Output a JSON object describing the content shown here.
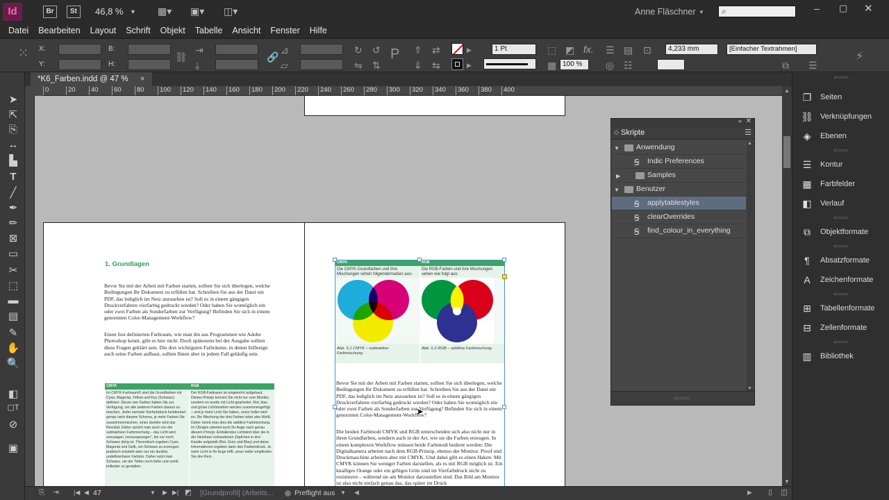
{
  "appbar": {
    "logo": "Id",
    "bridge": "Br",
    "stock": "St",
    "zoom": "46,8 %",
    "user": "Anne Fläschner"
  },
  "menu": [
    "Datei",
    "Bearbeiten",
    "Layout",
    "Schrift",
    "Objekt",
    "Tabelle",
    "Ansicht",
    "Fenster",
    "Hilfe"
  ],
  "control": {
    "x_label": "X:",
    "y_label": "Y:",
    "b_label": "B:",
    "h_label": "H:",
    "stroke_weight": "1 Pt",
    "opacity": "100 %",
    "fx": "fx.",
    "size_value": "4,233 mm",
    "frame_style": "[Einfacher Textrahmen]"
  },
  "tab": {
    "title": "*K6_Farben.indd @ 47 %",
    "close": "×"
  },
  "ruler": {
    "ticks": [
      "0",
      "20",
      "40",
      "60",
      "80",
      "100",
      "120",
      "140",
      "160",
      "180",
      "200",
      "220",
      "240",
      "260",
      "280",
      "300",
      "320",
      "340",
      "360",
      "380",
      "400"
    ]
  },
  "left_page": {
    "heading": "1.  Grundlagen",
    "para1": "Bevor Sie mit der Arbeit mit Farben starten, sollten Sie sich überlegen, welche Bedingungen Ihr Dokument zu erfüllen hat. Schreiben Sie aus der Datei ein PDF, das lediglich im Netz anzusehen ist? Soll es in einem gängigen Druckverfahren vierfarbig gedruckt werden? Oder haben Sie womöglich ein oder zwei Farben als Sonderfarben zur Verfügung? Befinden Sie sich in einem genormten Color-Management-Workflow?",
    "para2": "Einen fest definierten Farbraum, wie man ihn aus Programmen wie Adobe Photoshop kennt, gibt es hier nicht. Doch spätestens bei der Ausgabe sollten diese Fragen geklärt sein. Die drei wichtigsten Farbräume, in denen InDesign auch seine Farben aufbaut, sollten Ihnen aber in jedem Fall geläufig sein.",
    "table_h1": "CMYK",
    "table_h2": "RGB",
    "table_col1": "Im CMYK-Farbraum® sind die Grundfarben mit Cyan, Magenta, Yellow und Key (Schwarz) definiert. Dieser vier Farben haben Sie zur Verfügung, um alle anderen Farben daraus zu mischen. Jeder normale Vierfarbdruck funktioniert genau nach diesem Schema, je mehr Farben Sie zusammenmischen, umso dunkler wird das Resultat. Daher spricht man auch von der subtraktiven Farbmischung – das Licht wird sozusagen „herausgezogen“, bis nur noch Schwarz übrig ist. Theoretisch ergeben Cyan, Magenta und Gelb, um Schwarz zu erzeugen; praktisch entsteht aber nur ein dunkler, undefinierbarer Farbton. Daher nutzt man Schwarz, um die Tiefen noch tiefer und somit brillanter zu gestalten.",
    "table_col2": "Der RGB-Farbraum ist umgekehrt aufgebaut. Dieses Prinzip kennen Sie nicht nur vom Monitor, sondern es wurde mit Licht gearbeitet. Rot, blau und grüne Lichtstrahlen werden zusammengefügt – und je mehr Licht Sie haben, umso heller wird es: Die Mischung der drei Farben wäre also Weiß. Daher nennt man dies die additive Farbmischung. Im Übrigen arbeitet auch Ihr Auge nach genau diesem Prinzip: Einfallendes Lichtwird über die in der Netzhaut vorhandenen Zäpfchen in drei Kanäle aufgeteilt (Rot, Grün und Blau) und diese Informationen ergeben dann den Farbeindruck. Je mehr Licht in Ihr Auge trifft, umso heller empfinden Sie den Reiz."
  },
  "right_page": {
    "t_h1": "CMYK",
    "t_h2": "RGB",
    "cap_top1": "Die CMYK-Grundfarben und ihre Mischungen sehen folgendermaßen aus:",
    "cap_top2": "Die RGB-Farben und ihre Mischungen sehen wie folgt aus:",
    "fig1": "Abb. 6.1  CMYK – subtraktive Farbmischung.",
    "fig2": "Abb. 6.2  RGB – additive Farbmischung.",
    "para1": "Bevor Sie mit der Arbeit mit Farben starten, sollten Sie sich überlegen, welche Bedingungen Ihr Dokument zu erfüllen hat. Schreiben Sie aus der Datei ein PDF, das lediglich im Netz anzusehen ist? Soll es in einem gängigen Druckverfahren vierfarbig gedruckt werden? Oder haben Sie womöglich ein oder zwei Farben als Sonderfarben zur Verfügung? Befinden Sie sich in einem genormten Color-Management-Workflow?",
    "para2": "Die beiden Farbmodi CMYK und RGB unterscheiden sich also nicht nur in ihren Grundfarben, sondern auch in der Art, wie sie die Farben erzeugen. In einem komplexen Workflow müssen beide Farbmodi bedient werden: Die Digitalkamera arbeitet nach dem RGB-Prinzip, ebenso der Monitor. Proof und Druckmaschine arbeiten aber mit CMYK. Und dabei gibt es einen Haken: Mit CMYK können Sie weniger Farben darstellen, als es mit RGB möglich ist. Ein knalliges Orange oder ein giftiges Grün sind im Vierfarbdruck nicht zu resistieren – während sie am Monitor darzustellen sind. Das Bild am Monitor ist also nicht einfach genau das, das später im Druck"
  },
  "scripts_panel": {
    "title": "Skripte",
    "rows": [
      {
        "label": "Anwendung",
        "kind": "folder",
        "level": 0,
        "expanded": true
      },
      {
        "label": "Indic Preferences",
        "kind": "script",
        "level": 1
      },
      {
        "label": "Samples",
        "kind": "folder",
        "level": 1,
        "expanded": false
      },
      {
        "label": "Benutzer",
        "kind": "folder",
        "level": 0,
        "expanded": true
      },
      {
        "label": "applytablestyles",
        "kind": "script",
        "level": 1,
        "selected": true
      },
      {
        "label": "clearOverrides",
        "kind": "script",
        "level": 1
      },
      {
        "label": "find_colour_in_everything",
        "kind": "script",
        "level": 1
      }
    ]
  },
  "panels": [
    {
      "label": "Seiten",
      "icon": "pages-icon"
    },
    {
      "label": "Verknüpfungen",
      "icon": "links-icon"
    },
    {
      "label": "Ebenen",
      "icon": "layers-icon"
    },
    {
      "label": "Kontur",
      "icon": "stroke-icon"
    },
    {
      "label": "Farbfelder",
      "icon": "swatches-icon"
    },
    {
      "label": "Verlauf",
      "icon": "gradient-icon"
    },
    {
      "label": "Objektformate",
      "icon": "object-styles-icon"
    },
    {
      "label": "Absatzformate",
      "icon": "paragraph-styles-icon"
    },
    {
      "label": "Zeichenformate",
      "icon": "character-styles-icon"
    },
    {
      "label": "Tabellenformate",
      "icon": "table-styles-icon"
    },
    {
      "label": "Zellenformate",
      "icon": "cell-styles-icon"
    },
    {
      "label": "Bibliothek",
      "icon": "library-icon"
    }
  ],
  "status": {
    "page": "47",
    "profile": "[Grundprofil] (Arbeits...",
    "preflight": "Preflight aus"
  },
  "colors": {
    "accent_green": "#3aa565",
    "selection": "#5f6c80",
    "cyan": "#1fb1e6",
    "magenta": "#e4007c",
    "yellow": "#fff200",
    "red": "#d9001b",
    "green": "#00963f",
    "blue": "#2e3192"
  }
}
